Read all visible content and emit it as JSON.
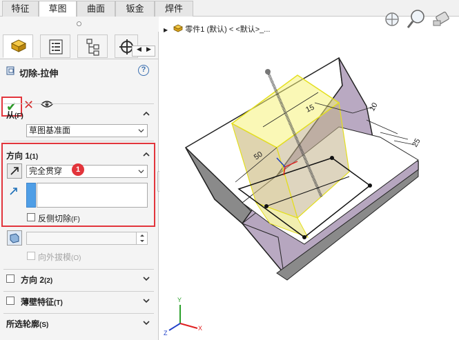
{
  "tabs": [
    {
      "label": "特征"
    },
    {
      "label": "草图"
    },
    {
      "label": "曲面"
    },
    {
      "label": "钣金"
    },
    {
      "label": "焊件"
    }
  ],
  "feature": {
    "title": "切除-拉伸"
  },
  "from": {
    "label": "从",
    "key": "(F)",
    "value": "草图基准面"
  },
  "direction1": {
    "label": "方向 1",
    "key": "(1)",
    "end_condition": "完全贯穿",
    "badge": "1",
    "flip_side_label": "反侧切除",
    "flip_side_key": "(F)"
  },
  "draft": {
    "label": "向外拔模",
    "key": "(O)"
  },
  "direction2": {
    "label": "方向 2",
    "key": "(2)"
  },
  "thin": {
    "label": "薄壁特征",
    "key": "(T)"
  },
  "contours": {
    "label": "所选轮廓",
    "key": "(S)"
  },
  "viewport": {
    "tree_label": "零件1 (默认) < <默认>_...",
    "dims": [
      "15",
      "10",
      "50",
      "25"
    ],
    "triad": {
      "x": "X",
      "y": "Y",
      "z": "Z"
    }
  },
  "colors": {
    "highlight": "#e2343b",
    "accept": "#2d9a2a",
    "model_face": "#b9a9c2",
    "sketch": "#f2ef3a"
  }
}
